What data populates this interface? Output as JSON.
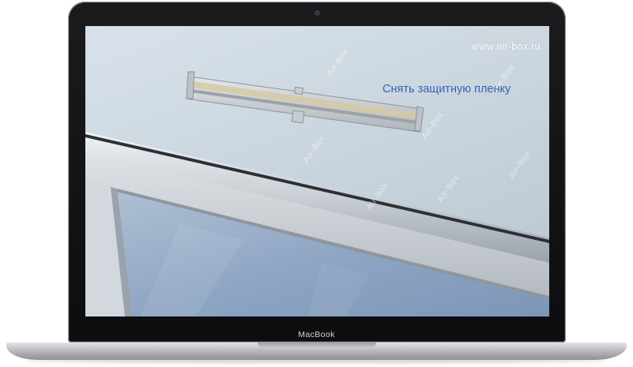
{
  "device": {
    "brand_label": "MacBook"
  },
  "screen": {
    "site_url": "www.air-box.ru",
    "instruction_caption": "Снять защитную пленку",
    "watermark_text": "Air-Box"
  },
  "colors": {
    "caption": "#3b5fb4",
    "url": "#ffffff",
    "bezel": "#111113",
    "body_silver": "#b9bbbf"
  }
}
